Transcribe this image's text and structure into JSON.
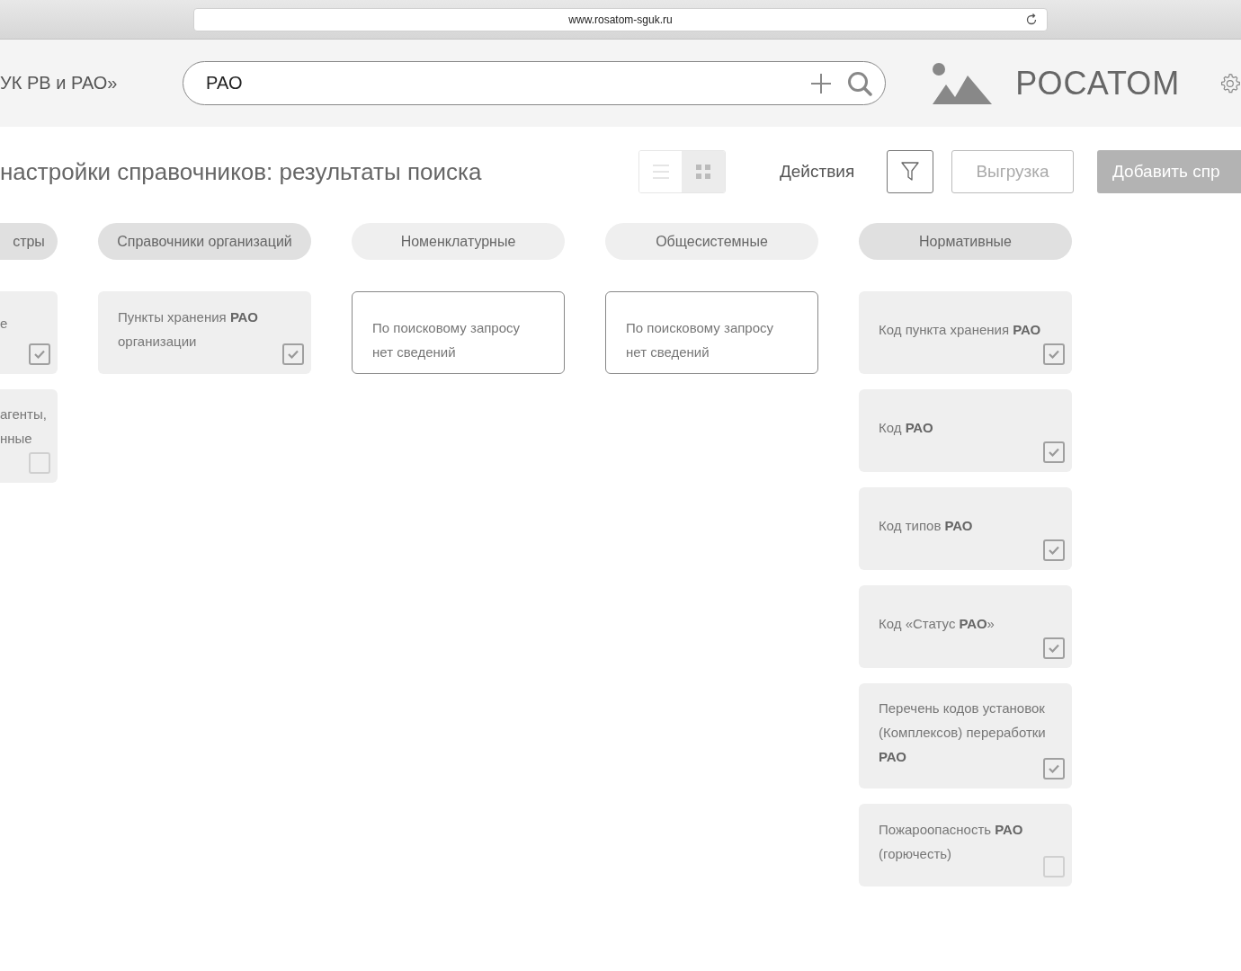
{
  "browser": {
    "url": "www.rosatom-sguk.ru"
  },
  "header": {
    "system_name": "УК РВ и РАО»",
    "search": {
      "value": "РАО"
    },
    "logo_text": "РОСАТОМ"
  },
  "toolbar": {
    "title": "настройки справочников: результаты поиска",
    "view_modes": [
      {
        "kind": "list",
        "selected": false
      },
      {
        "kind": "grid",
        "selected": true
      }
    ],
    "actions_label": "Действия",
    "export_button": "Выгрузка",
    "add_button": "Добавить спр"
  },
  "columns": [
    {
      "category": "стры",
      "selected": true,
      "cards": [
        {
          "kind": "result",
          "text": "е",
          "checked": true
        },
        {
          "kind": "result",
          "text": "агенты,\nнные",
          "checked": false
        }
      ]
    },
    {
      "category": "Справочники организаций",
      "selected": true,
      "cards": [
        {
          "kind": "result",
          "text": "Пункты хранения **РАО** организации",
          "checked": true
        }
      ]
    },
    {
      "category": "Номенклатурные",
      "selected": false,
      "cards": [
        {
          "kind": "empty",
          "text": "По поисковому запросу нет сведений"
        }
      ]
    },
    {
      "category": "Общесистемные",
      "selected": false,
      "cards": [
        {
          "kind": "empty",
          "text": "По поисковому запросу нет сведений"
        }
      ]
    },
    {
      "category": "Нормативные",
      "selected": true,
      "cards": [
        {
          "kind": "result",
          "text": "Код пункта хранения **РАО**",
          "checked": true
        },
        {
          "kind": "result",
          "text": "Код **РАО**",
          "checked": true
        },
        {
          "kind": "result",
          "text": "Код типов **РАО**",
          "checked": true
        },
        {
          "kind": "result",
          "text": "Код «Статус **РАО**»",
          "checked": true
        },
        {
          "kind": "result",
          "text": "Перечень кодов установок (Комплексов) переработки **РАО**",
          "checked": true
        },
        {
          "kind": "result",
          "text": "Пожароопасность **РАО** (горючесть)",
          "checked": false
        }
      ]
    }
  ]
}
